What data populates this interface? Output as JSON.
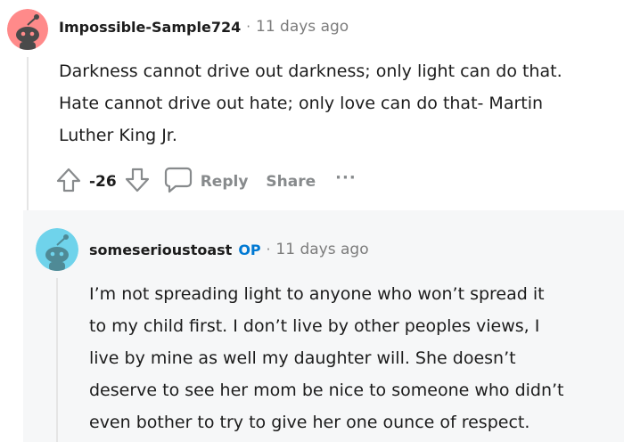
{
  "comment": {
    "username": "Impossible-Sample724",
    "separator": "·",
    "time": "11 days ago",
    "lines": [
      "Darkness cannot drive out darkness; only light can do that.",
      "Hate cannot drive out hate; only love can do that- Martin",
      "Luther King Jr."
    ],
    "vote_count": "-26",
    "reply_label": "Reply",
    "share_label": "Share",
    "more_label": "···",
    "avatar_color": "#ff8a8a"
  },
  "reply": {
    "username": "someserioustoast",
    "op_badge": "OP",
    "separator": "·",
    "time": "11 days ago",
    "lines": [
      "I’m not spreading light to anyone who won’t spread it",
      "to my child first. I don’t live by other peoples views, I",
      "live by mine as well my daughter will. She doesn’t",
      "deserve to see her mom be nice to someone who didn’t",
      "even bother to try to give her one ounce of respect."
    ],
    "avatar_color": "#6fd3eb"
  },
  "colors": {
    "op_accent": "#0079d3",
    "muted": "#878a8c",
    "reply_background": "#f6f7f8"
  }
}
